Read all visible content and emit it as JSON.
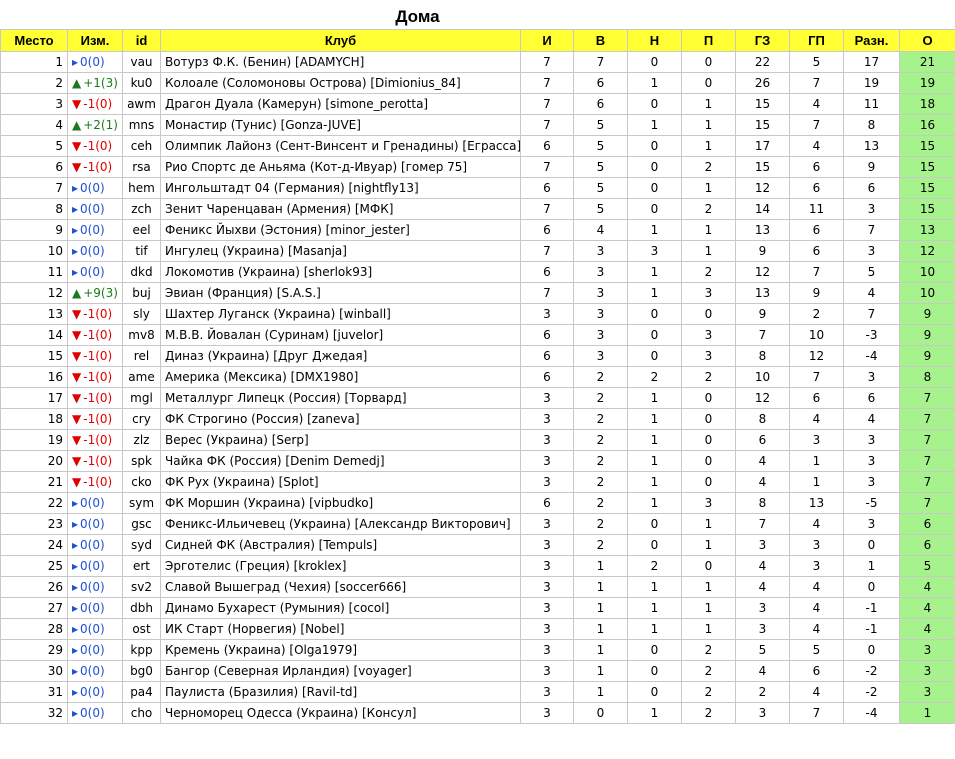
{
  "title": "Дома",
  "colors": {
    "header": "#ffff33",
    "points": "#a6f28c",
    "up": "#1c7a1c",
    "down": "#e00000",
    "same": "#1f4fd6"
  },
  "headers": {
    "place": "Место",
    "change": "Изм.",
    "id": "id",
    "club": "Клуб",
    "played": "И",
    "wins": "В",
    "draws": "Н",
    "losses": "П",
    "gf": "ГЗ",
    "ga": "ГП",
    "diff": "Разн.",
    "points": "О"
  },
  "rows": [
    {
      "place": "1",
      "dir": "same",
      "change": "0(0)",
      "id": "vau",
      "club": "Вотурз Ф.К. (Бенин) [ADAMYCH]",
      "p": "7",
      "w": "7",
      "d": "0",
      "l": "0",
      "gf": "22",
      "ga": "5",
      "diff": "17",
      "pts": "21"
    },
    {
      "place": "2",
      "dir": "up",
      "change": "+1(3)",
      "id": "ku0",
      "club": "Колоале (Соломоновы Острова) [Dimionius_84]",
      "p": "7",
      "w": "6",
      "d": "1",
      "l": "0",
      "gf": "26",
      "ga": "7",
      "diff": "19",
      "pts": "19"
    },
    {
      "place": "3",
      "dir": "down",
      "change": "-1(0)",
      "id": "awm",
      "club": "Драгон Дуала (Камерун) [simone_perotta]",
      "p": "7",
      "w": "6",
      "d": "0",
      "l": "1",
      "gf": "15",
      "ga": "4",
      "diff": "11",
      "pts": "18"
    },
    {
      "place": "4",
      "dir": "up",
      "change": "+2(1)",
      "id": "mns",
      "club": "Монастир (Тунис) [Gonza-JUVE]",
      "p": "7",
      "w": "5",
      "d": "1",
      "l": "1",
      "gf": "15",
      "ga": "7",
      "diff": "8",
      "pts": "16"
    },
    {
      "place": "5",
      "dir": "down",
      "change": "-1(0)",
      "id": "ceh",
      "club": "Олимпик Лайонз (Сент-Винсент и Гренадины) [Еграсса]",
      "p": "6",
      "w": "5",
      "d": "0",
      "l": "1",
      "gf": "17",
      "ga": "4",
      "diff": "13",
      "pts": "15"
    },
    {
      "place": "6",
      "dir": "down",
      "change": "-1(0)",
      "id": "rsa",
      "club": "Рио Спортс де Аньяма (Кот-д-Ивуар) [гомер 75]",
      "p": "7",
      "w": "5",
      "d": "0",
      "l": "2",
      "gf": "15",
      "ga": "6",
      "diff": "9",
      "pts": "15"
    },
    {
      "place": "7",
      "dir": "same",
      "change": "0(0)",
      "id": "hem",
      "club": "Ингольштадт 04 (Германия) [nightfly13]",
      "p": "6",
      "w": "5",
      "d": "0",
      "l": "1",
      "gf": "12",
      "ga": "6",
      "diff": "6",
      "pts": "15"
    },
    {
      "place": "8",
      "dir": "same",
      "change": "0(0)",
      "id": "zch",
      "club": "Зенит Чаренцаван (Армения) [МФК]",
      "p": "7",
      "w": "5",
      "d": "0",
      "l": "2",
      "gf": "14",
      "ga": "11",
      "diff": "3",
      "pts": "15"
    },
    {
      "place": "9",
      "dir": "same",
      "change": "0(0)",
      "id": "eel",
      "club": "Феникс Йыхви (Эстония) [minor_jester]",
      "p": "6",
      "w": "4",
      "d": "1",
      "l": "1",
      "gf": "13",
      "ga": "6",
      "diff": "7",
      "pts": "13"
    },
    {
      "place": "10",
      "dir": "same",
      "change": "0(0)",
      "id": "tif",
      "club": "Ингулец (Украина) [Masanja]",
      "p": "7",
      "w": "3",
      "d": "3",
      "l": "1",
      "gf": "9",
      "ga": "6",
      "diff": "3",
      "pts": "12"
    },
    {
      "place": "11",
      "dir": "same",
      "change": "0(0)",
      "id": "dkd",
      "club": "Локомотив (Украина) [sherlok93]",
      "p": "6",
      "w": "3",
      "d": "1",
      "l": "2",
      "gf": "12",
      "ga": "7",
      "diff": "5",
      "pts": "10"
    },
    {
      "place": "12",
      "dir": "up",
      "change": "+9(3)",
      "id": "buj",
      "club": "Эвиан (Франция) [S.A.S.]",
      "p": "7",
      "w": "3",
      "d": "1",
      "l": "3",
      "gf": "13",
      "ga": "9",
      "diff": "4",
      "pts": "10"
    },
    {
      "place": "13",
      "dir": "down",
      "change": "-1(0)",
      "id": "sly",
      "club": "Шахтер Луганск (Украина) [winball]",
      "p": "3",
      "w": "3",
      "d": "0",
      "l": "0",
      "gf": "9",
      "ga": "2",
      "diff": "7",
      "pts": "9"
    },
    {
      "place": "14",
      "dir": "down",
      "change": "-1(0)",
      "id": "mv8",
      "club": "М.В.В. Йовалан (Суринам) [juvelor]",
      "p": "6",
      "w": "3",
      "d": "0",
      "l": "3",
      "gf": "7",
      "ga": "10",
      "diff": "-3",
      "pts": "9"
    },
    {
      "place": "15",
      "dir": "down",
      "change": "-1(0)",
      "id": "rel",
      "club": "Диназ (Украина) [Друг Джедая]",
      "p": "6",
      "w": "3",
      "d": "0",
      "l": "3",
      "gf": "8",
      "ga": "12",
      "diff": "-4",
      "pts": "9"
    },
    {
      "place": "16",
      "dir": "down",
      "change": "-1(0)",
      "id": "ame",
      "club": "Америка (Мексика) [DMX1980]",
      "p": "6",
      "w": "2",
      "d": "2",
      "l": "2",
      "gf": "10",
      "ga": "7",
      "diff": "3",
      "pts": "8"
    },
    {
      "place": "17",
      "dir": "down",
      "change": "-1(0)",
      "id": "mgl",
      "club": "Металлург Липецк (Россия) [Торвард]",
      "p": "3",
      "w": "2",
      "d": "1",
      "l": "0",
      "gf": "12",
      "ga": "6",
      "diff": "6",
      "pts": "7"
    },
    {
      "place": "18",
      "dir": "down",
      "change": "-1(0)",
      "id": "cry",
      "club": "ФК Строгино (Россия) [zaneva]",
      "p": "3",
      "w": "2",
      "d": "1",
      "l": "0",
      "gf": "8",
      "ga": "4",
      "diff": "4",
      "pts": "7"
    },
    {
      "place": "19",
      "dir": "down",
      "change": "-1(0)",
      "id": "zlz",
      "club": "Верес (Украина) [Serp]",
      "p": "3",
      "w": "2",
      "d": "1",
      "l": "0",
      "gf": "6",
      "ga": "3",
      "diff": "3",
      "pts": "7"
    },
    {
      "place": "20",
      "dir": "down",
      "change": "-1(0)",
      "id": "spk",
      "club": "Чайка ФК (Россия) [Denim Demedj]",
      "p": "3",
      "w": "2",
      "d": "1",
      "l": "0",
      "gf": "4",
      "ga": "1",
      "diff": "3",
      "pts": "7"
    },
    {
      "place": "21",
      "dir": "down",
      "change": "-1(0)",
      "id": "cko",
      "club": "ФК Рух (Украина) [Splot]",
      "p": "3",
      "w": "2",
      "d": "1",
      "l": "0",
      "gf": "4",
      "ga": "1",
      "diff": "3",
      "pts": "7"
    },
    {
      "place": "22",
      "dir": "same",
      "change": "0(0)",
      "id": "sym",
      "club": "ФК Моршин (Украина) [vipbudko]",
      "p": "6",
      "w": "2",
      "d": "1",
      "l": "3",
      "gf": "8",
      "ga": "13",
      "diff": "-5",
      "pts": "7"
    },
    {
      "place": "23",
      "dir": "same",
      "change": "0(0)",
      "id": "gsc",
      "club": "Феникс-Ильичевец (Украина) [Александр Викторович]",
      "p": "3",
      "w": "2",
      "d": "0",
      "l": "1",
      "gf": "7",
      "ga": "4",
      "diff": "3",
      "pts": "6"
    },
    {
      "place": "24",
      "dir": "same",
      "change": "0(0)",
      "id": "syd",
      "club": "Сидней ФК (Австралия) [Tempuls]",
      "p": "3",
      "w": "2",
      "d": "0",
      "l": "1",
      "gf": "3",
      "ga": "3",
      "diff": "0",
      "pts": "6"
    },
    {
      "place": "25",
      "dir": "same",
      "change": "0(0)",
      "id": "ert",
      "club": "Эрготелис (Греция) [kroklex]",
      "p": "3",
      "w": "1",
      "d": "2",
      "l": "0",
      "gf": "4",
      "ga": "3",
      "diff": "1",
      "pts": "5"
    },
    {
      "place": "26",
      "dir": "same",
      "change": "0(0)",
      "id": "sv2",
      "club": "Славой Вышеград (Чехия) [soccer666]",
      "p": "3",
      "w": "1",
      "d": "1",
      "l": "1",
      "gf": "4",
      "ga": "4",
      "diff": "0",
      "pts": "4"
    },
    {
      "place": "27",
      "dir": "same",
      "change": "0(0)",
      "id": "dbh",
      "club": "Динамо Бухарест (Румыния) [cocol]",
      "p": "3",
      "w": "1",
      "d": "1",
      "l": "1",
      "gf": "3",
      "ga": "4",
      "diff": "-1",
      "pts": "4"
    },
    {
      "place": "28",
      "dir": "same",
      "change": "0(0)",
      "id": "ost",
      "club": "ИК Старт (Норвегия) [Nobel]",
      "p": "3",
      "w": "1",
      "d": "1",
      "l": "1",
      "gf": "3",
      "ga": "4",
      "diff": "-1",
      "pts": "4"
    },
    {
      "place": "29",
      "dir": "same",
      "change": "0(0)",
      "id": "kpp",
      "club": "Кремень (Украина) [Olga1979]",
      "p": "3",
      "w": "1",
      "d": "0",
      "l": "2",
      "gf": "5",
      "ga": "5",
      "diff": "0",
      "pts": "3"
    },
    {
      "place": "30",
      "dir": "same",
      "change": "0(0)",
      "id": "bg0",
      "club": "Бангор (Северная Ирландия) [voyager]",
      "p": "3",
      "w": "1",
      "d": "0",
      "l": "2",
      "gf": "4",
      "ga": "6",
      "diff": "-2",
      "pts": "3"
    },
    {
      "place": "31",
      "dir": "same",
      "change": "0(0)",
      "id": "pa4",
      "club": "Паулиста (Бразилия) [Ravil-td]",
      "p": "3",
      "w": "1",
      "d": "0",
      "l": "2",
      "gf": "2",
      "ga": "4",
      "diff": "-2",
      "pts": "3"
    },
    {
      "place": "32",
      "dir": "same",
      "change": "0(0)",
      "id": "cho",
      "club": "Черноморец Одесса (Украина) [Консул]",
      "p": "3",
      "w": "0",
      "d": "1",
      "l": "2",
      "gf": "3",
      "ga": "7",
      "diff": "-4",
      "pts": "1"
    }
  ]
}
